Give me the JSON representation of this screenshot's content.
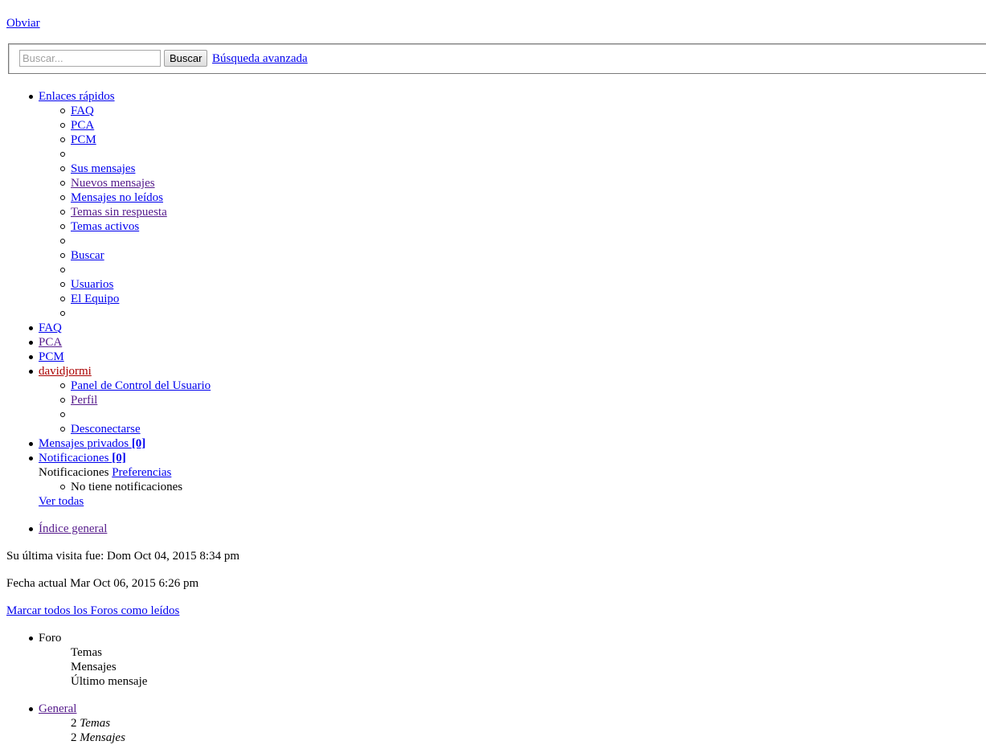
{
  "skip_label": "Obviar",
  "search": {
    "placeholder": "Buscar...",
    "value": "",
    "button_label": "Buscar",
    "advanced_label": "Búsqueda avanzada"
  },
  "quick_links": {
    "label": "Enlaces rápidos",
    "items": [
      "FAQ",
      "PCA",
      "PCM",
      "",
      "Sus mensajes",
      "Nuevos mensajes",
      "Mensajes no leídos",
      "Temas sin respuesta",
      "Temas activos",
      "",
      "Buscar",
      "",
      "Usuarios",
      "El Equipo",
      ""
    ]
  },
  "nav": {
    "faq": "FAQ",
    "pca": "PCA",
    "pcm": "PCM",
    "username": "davidjormi",
    "user_menu": [
      "Panel de Control del Usuario",
      "Perfil",
      "",
      "Desconectarse"
    ],
    "pm_label": "Mensajes privados",
    "pm_count": "[0]",
    "notif_label": "Notificaciones",
    "notif_count": "[0]",
    "notif_header": "Notificaciones",
    "notif_prefs": "Preferencias",
    "notif_empty": "No tiene notificaciones",
    "notif_view_all": "Ver todas"
  },
  "breadcrumb": {
    "index": "Índice general"
  },
  "last_visit": "Su última visita fue: Dom Oct 04, 2015 8:34 pm",
  "current_date": "Fecha actual Mar Oct 06, 2015 6:26 pm",
  "mark_read": "Marcar todos los Foros como leídos",
  "forum_header": {
    "forum": "Foro",
    "topics": "Temas",
    "posts": "Mensajes",
    "last_post": "Último mensaje"
  },
  "forums": [
    {
      "name": "General",
      "topics_count": "2",
      "topics_label": "Temas",
      "posts_count": "2",
      "posts_label": "Mensajes"
    }
  ]
}
